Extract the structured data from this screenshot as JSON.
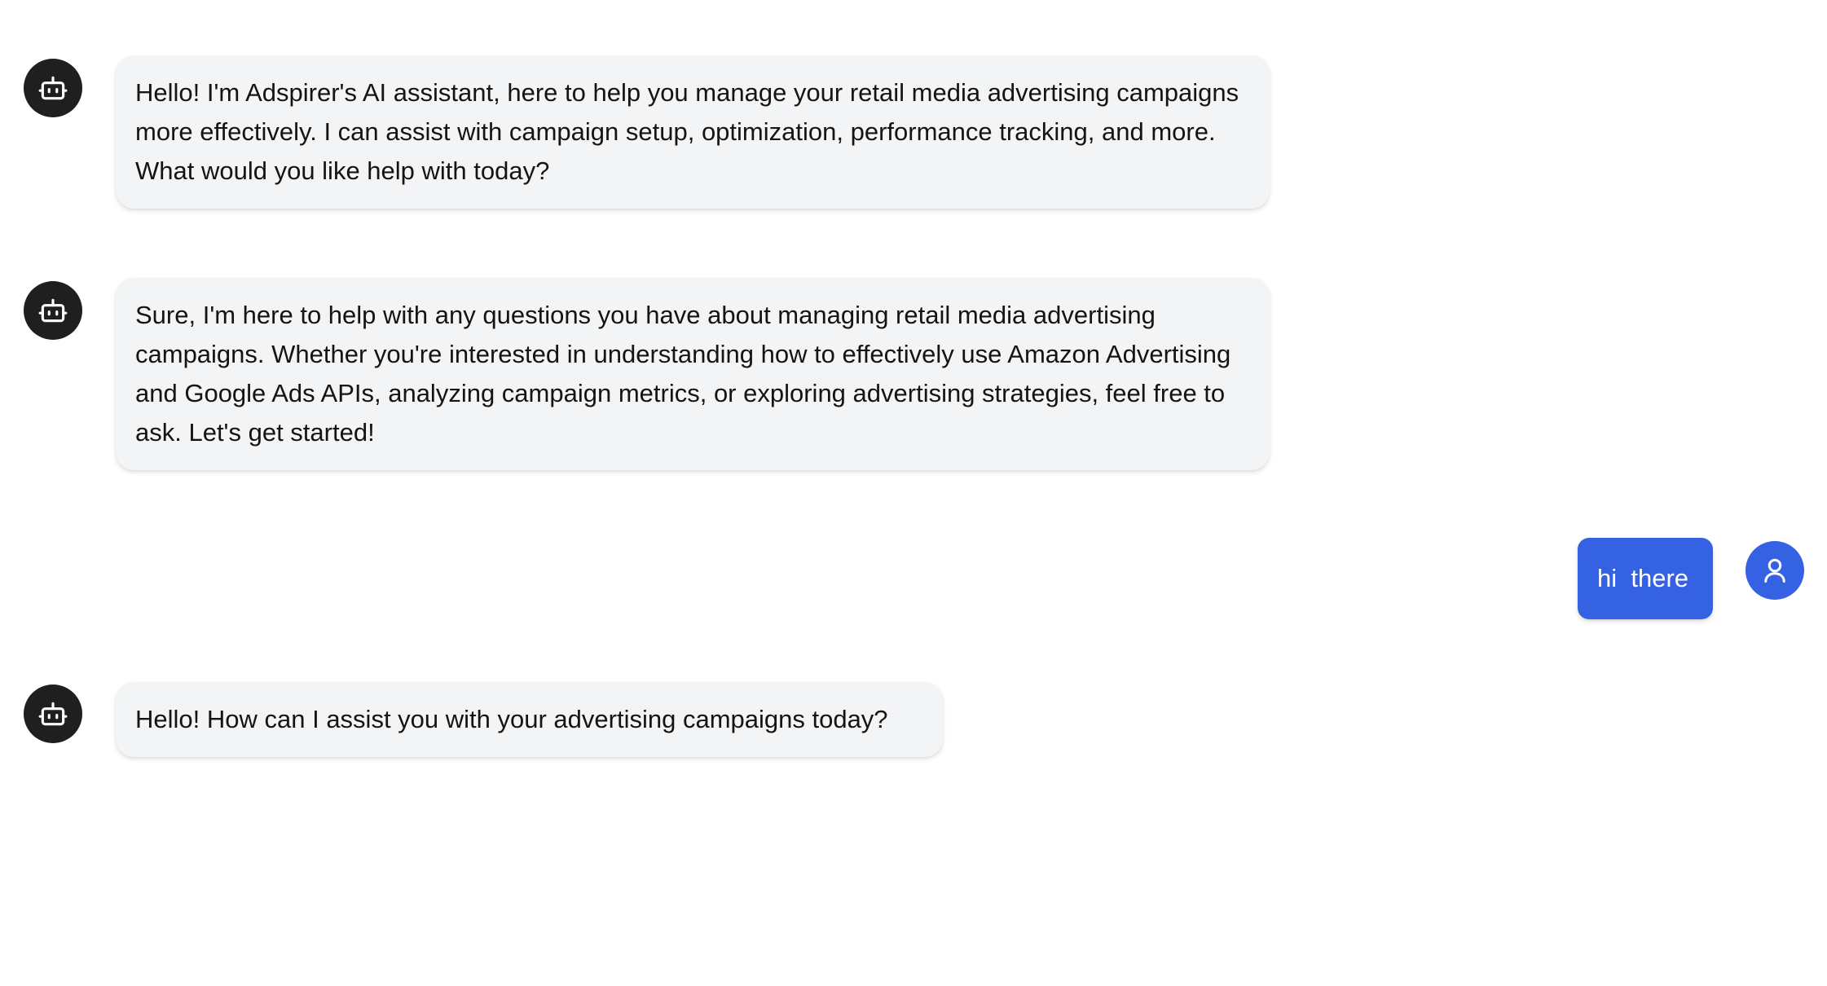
{
  "chat": {
    "messages": [
      {
        "role": "assistant",
        "avatar_icon": "robot-icon",
        "text": "Hello! I'm Adspirer's AI assistant, here to help you manage your retail media advertising campaigns more effectively. I can assist with campaign setup, optimization, performance tracking, and more. What would you like help with today?"
      },
      {
        "role": "assistant",
        "avatar_icon": "robot-icon",
        "text": "Sure, I'm here to help with any questions you have about managing retail media advertising campaigns. Whether you're interested in understanding how to effectively use Amazon Advertising and Google Ads APIs, analyzing campaign metrics, or exploring advertising strategies, feel free to ask. Let's get started!"
      },
      {
        "role": "user",
        "avatar_icon": "user-icon",
        "text": "hi  there"
      },
      {
        "role": "assistant",
        "avatar_icon": "robot-icon",
        "text": "Hello! How can I assist you with your advertising campaigns today?"
      }
    ]
  },
  "colors": {
    "bot_avatar_bg": "#1f1f1f",
    "bot_bubble_bg": "#f3f4f6",
    "user_bubble_bg": "#3561e3",
    "user_avatar_bg": "#3561e3",
    "text": "#141414",
    "user_text": "#ffffff"
  }
}
